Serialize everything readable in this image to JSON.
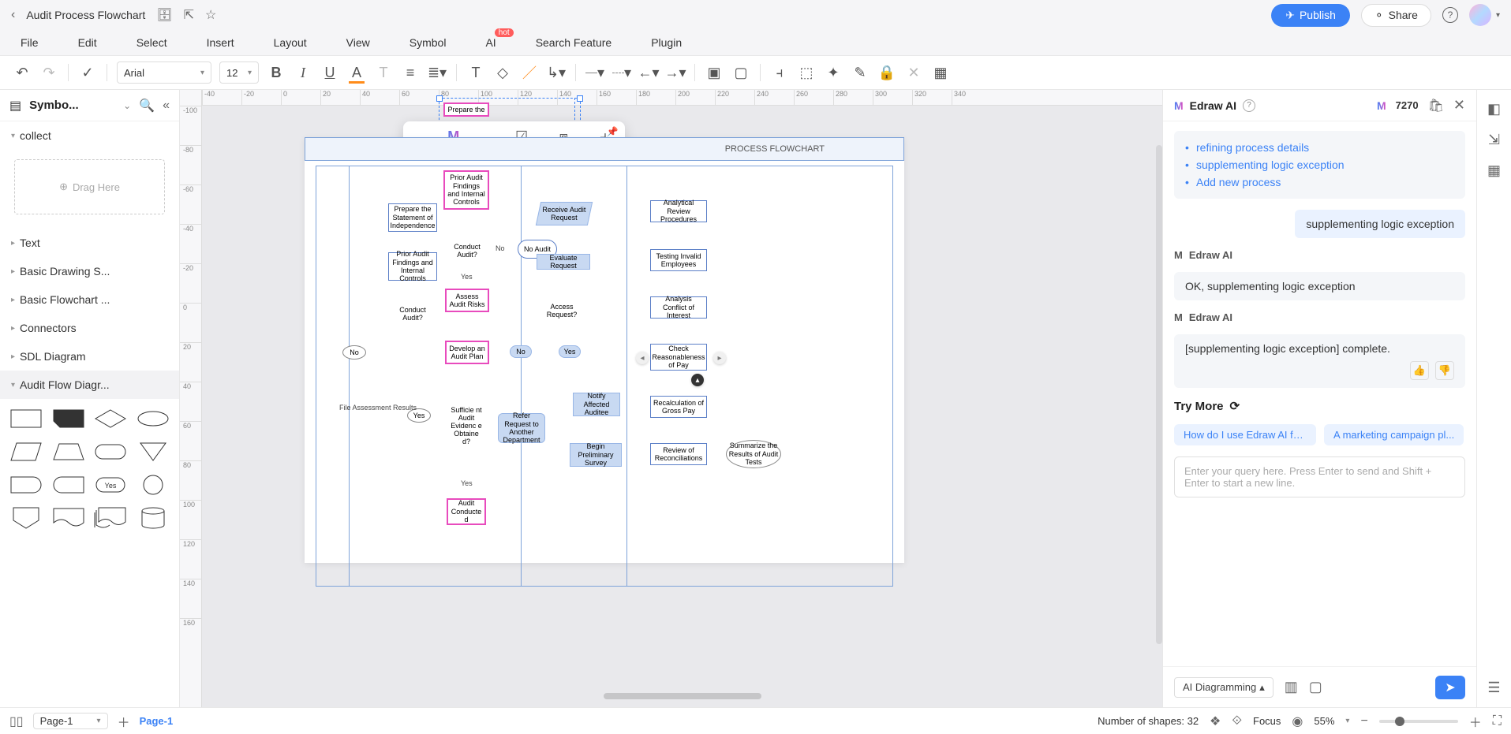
{
  "document": {
    "title": "Audit Process Flowchart"
  },
  "menus": {
    "file": "File",
    "edit": "Edit",
    "select": "Select",
    "insert": "Insert",
    "layout": "Layout",
    "view": "View",
    "symbol": "Symbol",
    "ai": "AI",
    "ai_tag": "hot",
    "search": "Search Feature",
    "plugin": "Plugin"
  },
  "toolbar": {
    "font": "Arial",
    "size": "12"
  },
  "header_actions": {
    "publish": "Publish",
    "share": "Share"
  },
  "sidebar": {
    "title": "Symbo...",
    "collect": "collect",
    "drag_here": "Drag Here",
    "categories": [
      "Text",
      "Basic Drawing S...",
      "Basic Flowchart ...",
      "Connectors",
      "SDL Diagram",
      "Audit Flow Diagr..."
    ]
  },
  "canvas": {
    "hruler": [
      "-40",
      "-20",
      "0",
      "20",
      "40",
      "60",
      "80",
      "100",
      "120",
      "140",
      "160",
      "180",
      "200",
      "220",
      "240",
      "260",
      "280",
      "300",
      "320",
      "340"
    ],
    "vruler": [
      "-100",
      "-80",
      "-60",
      "-40",
      "-20",
      "0",
      "20",
      "40",
      "60",
      "80",
      "100",
      "120",
      "140",
      "160"
    ],
    "flow_title": "PROCESS FLOWCHART",
    "float_tb": {
      "analysis": "Flowchart Analysis",
      "select": "Select",
      "group": "Group",
      "align": "Align"
    },
    "boxes": {
      "prepare_top": "Prepare the",
      "prior_findings_p": "Prior Audit Findings and Internal Controls",
      "prepare_stmt": "Prepare the Statement of Independence",
      "prior_findings_b": "Prior Audit Findings and Internal Controls",
      "conduct_audit_p": "Conduct Audit?",
      "conduct_audit_b": "Conduct Audit?",
      "no_audit": "No Audit",
      "assess_risks": "Assess Audit Risks",
      "develop_plan": "Develop an Audit Plan",
      "sufficient": "Sufficie nt Audit Evidenc e Obtaine d?",
      "audit_conducted": "Audit Conducte d",
      "file_results": "File Assessment Results",
      "refer_request": "Refer Request to Another Department",
      "receive_req": "Receive Audit Request",
      "evaluate_req": "Evaluate Request",
      "access_req": "Access Request?",
      "notify_aud": "Notify Affected Auditee",
      "begin_survey": "Begin Preliminary Survey",
      "analytical": "Analytical Review Procedures",
      "testing": "Testing Invalid Employees",
      "analysis_conflict": "Analysis Conflict of Interest",
      "check_pay": "Check Reasonableness of Pay",
      "recalc": "Recalculation of Gross Pay",
      "review_recon": "Review of Reconciliations",
      "summarize": "Summarize the Results of Audit Tests",
      "lbl_no1": "No",
      "lbl_yes1": "Yes",
      "lbl_no2": "No",
      "lbl_yes2": "Yes",
      "lbl_yes3": "Yes",
      "lbl_yes4": "Yes",
      "lbl_no3": "No"
    }
  },
  "ai": {
    "brand": "Edraw AI",
    "credits": "7270",
    "suggestions": [
      "refining process details",
      "supplementing logic exception",
      "Add new process"
    ],
    "user_msg": "supplementing logic exception",
    "reply1": "OK, supplementing logic exception",
    "reply2": "[supplementing logic exception] complete.",
    "try_more": "Try More",
    "chip1": "How do I use Edraw AI fo...",
    "chip2": "A marketing campaign pl...",
    "placeholder": "Enter your query here. Press Enter to send and Shift + Enter to start a new line.",
    "mode": "AI Diagramming"
  },
  "status": {
    "page_select": "Page-1",
    "active_tab": "Page-1",
    "shape_count_lbl": "Number of shapes: 32",
    "focus": "Focus",
    "zoom": "55%"
  }
}
